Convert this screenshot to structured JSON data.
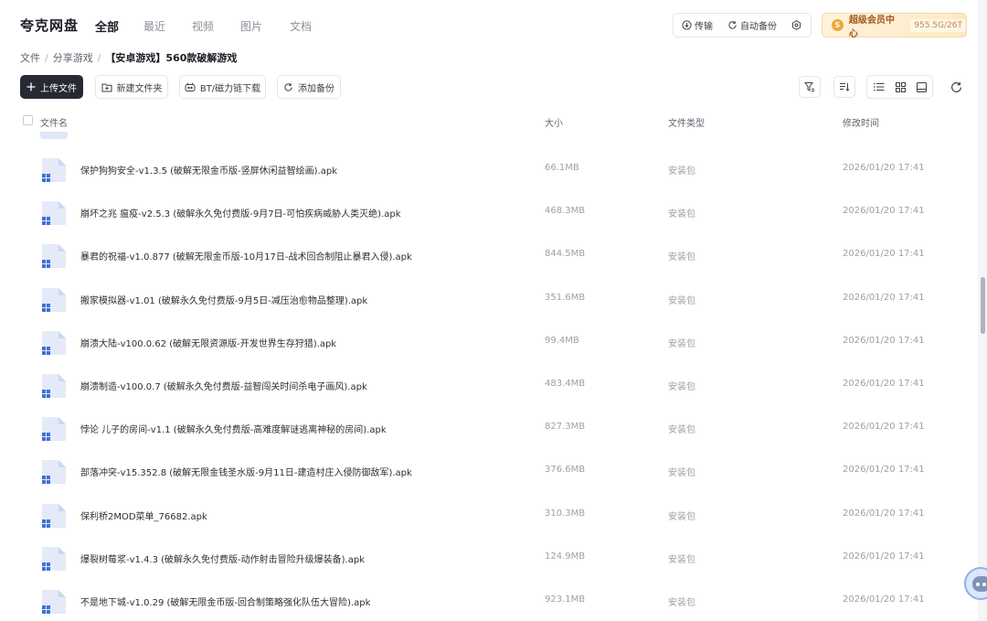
{
  "header": {
    "brand": "夸克网盘",
    "tabs": [
      {
        "label": "全部",
        "active": true
      },
      {
        "label": "最近",
        "active": false
      },
      {
        "label": "视频",
        "active": false
      },
      {
        "label": "图片",
        "active": false
      },
      {
        "label": "文档",
        "active": false
      }
    ],
    "transfer_label": "传输",
    "auto_backup_label": "自动备份",
    "vip": {
      "label": "超级会员中心",
      "storage": "955.5G/26T",
      "coin_symbol": "S"
    }
  },
  "breadcrumb": [
    "文件",
    "分享游戏",
    "【安卓游戏】560款破解游戏"
  ],
  "toolbar": {
    "upload_label": "上传文件",
    "new_folder_label": "新建文件夹",
    "bt_label": "BT/磁力链下载",
    "add_backup_label": "添加备份"
  },
  "table": {
    "columns": {
      "name": "文件名",
      "size": "大小",
      "type": "文件类型",
      "modified": "修改时间"
    },
    "rows": [
      {
        "name": "保护狗狗安全-v1.3.5 (破解无限金币版-竖屏休闲益智绘画).apk",
        "size": "66.1MB",
        "type": "安装包",
        "modified": "2026/01/20 17:41"
      },
      {
        "name": "崩坏之兆 瘟疫-v2.5.3 (破解永久免付费版-9月7日-可怕疾病威胁人类灭绝).apk",
        "size": "468.3MB",
        "type": "安装包",
        "modified": "2026/01/20 17:41"
      },
      {
        "name": "暴君的祝福-v1.0.877 (破解无限金币版-10月17日-战术回合制阻止暴君入侵).apk",
        "size": "844.5MB",
        "type": "安装包",
        "modified": "2026/01/20 17:41"
      },
      {
        "name": "搬家模拟器-v1.01 (破解永久免付费版-9月5日-减压治愈物品整理).apk",
        "size": "351.6MB",
        "type": "安装包",
        "modified": "2026/01/20 17:41"
      },
      {
        "name": "崩溃大陆-v100.0.62 (破解无限资源版-开发世界生存狩猎).apk",
        "size": "99.4MB",
        "type": "安装包",
        "modified": "2026/01/20 17:41"
      },
      {
        "name": "崩溃制造-v100.0.7 (破解永久免付费版-益智闯关时间杀电子画风).apk",
        "size": "483.4MB",
        "type": "安装包",
        "modified": "2026/01/20 17:41"
      },
      {
        "name": "悖论 儿子的房间-v1.1 (破解永久免付费版-高难度解谜逃离神秘的房间).apk",
        "size": "827.3MB",
        "type": "安装包",
        "modified": "2026/01/20 17:41"
      },
      {
        "name": "部落冲突-v15.352.8 (破解无限金钱圣水版-9月11日-建造村庄入侵防御敌军).apk",
        "size": "376.6MB",
        "type": "安装包",
        "modified": "2026/01/20 17:41"
      },
      {
        "name": "保利桥2MOD菜单_76682.apk",
        "size": "310.3MB",
        "type": "安装包",
        "modified": "2026/01/20 17:41"
      },
      {
        "name": "爆裂树莓浆-v1.4.3 (破解永久免付费版-动作射击冒险升级爆装备).apk",
        "size": "124.9MB",
        "type": "安装包",
        "modified": "2026/01/20 17:41"
      },
      {
        "name": "不是地下城-v1.0.29 (破解无限金币版-回合制策略强化队伍大冒险).apk",
        "size": "923.1MB",
        "type": "安装包",
        "modified": "2026/01/20 17:41"
      }
    ]
  },
  "colors": {
    "primary_button": "#262a33",
    "file_icon": "#dfe6f7",
    "file_icon_accent": "#3f6fd8",
    "vip_text": "#a2591d"
  },
  "icons": [
    "transfer-icon",
    "sync-icon",
    "settings-icon",
    "plus-icon",
    "folder-add-icon",
    "magnet-icon",
    "backup-icon",
    "filter-icon",
    "sort-icon",
    "list-view-icon",
    "grid-view-icon",
    "preview-view-icon",
    "refresh-icon",
    "apk-file-icon"
  ]
}
